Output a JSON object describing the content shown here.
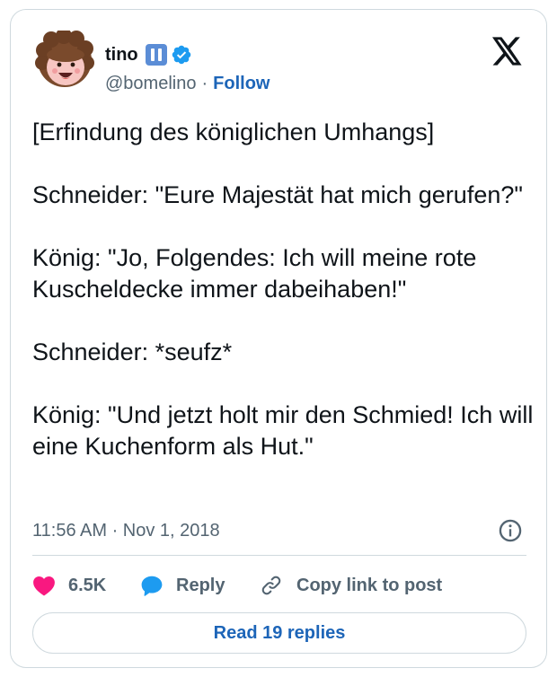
{
  "author": {
    "display_name": "tino",
    "handle": "@bomelino",
    "separator": "·",
    "follow_label": "Follow"
  },
  "tweet": {
    "paragraphs": [
      "[Erfindung des königlichen Umhangs]",
      "Schneider: \"Eure Majestät hat mich gerufen?\"",
      "König: \"Jo, Folgendes: Ich will meine rote Kuscheldecke immer dabeihaben!\"",
      "Schneider: *seufz*",
      "König: \"Und jetzt holt mir den Schmied! Ich will eine Kuchenform als Hut.\""
    ],
    "timestamp": "11:56 AM · Nov 1, 2018"
  },
  "actions": {
    "likes": "6.5K",
    "reply_label": "Reply",
    "copy_link_label": "Copy link to post",
    "read_replies_label": "Read 19 replies"
  },
  "icons": {
    "logo": "x-logo-icon",
    "verified": "verified-badge-icon",
    "pause": "pause-badge-icon",
    "info": "info-icon",
    "like": "heart-icon",
    "reply": "reply-bubble-icon",
    "link": "link-icon"
  },
  "colors": {
    "accent": "#1d65b8",
    "verified": "#1d9bf0",
    "like": "#f91880",
    "muted": "#536471",
    "border": "#cfd9de",
    "pause_badge": "#5b8dd6"
  }
}
